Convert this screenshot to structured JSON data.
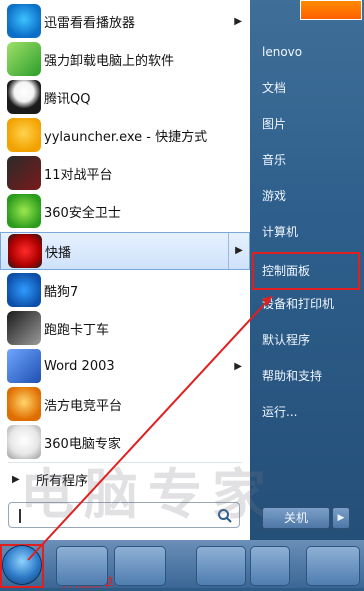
{
  "left_programs": [
    {
      "label": "迅雷看看播放器",
      "arrow": "▶",
      "icon": "xunlei-kankan-icon"
    },
    {
      "label": "强力卸载电脑上的软件",
      "arrow": "",
      "icon": "uninstall-icon"
    },
    {
      "label": "腾讯QQ",
      "arrow": "",
      "icon": "qq-penguin-icon"
    },
    {
      "label": "yylauncher.exe - 快捷方式",
      "arrow": "",
      "icon": "yy-launcher-icon"
    },
    {
      "label": "11对战平台",
      "arrow": "",
      "icon": "battle-platform-icon"
    },
    {
      "label": "360安全卫士",
      "arrow": "",
      "icon": "360-safe-icon"
    },
    {
      "label": "快播",
      "arrow": "▶",
      "icon": "kuaibo-icon"
    },
    {
      "label": "酷狗7",
      "arrow": "",
      "icon": "kugou-icon"
    },
    {
      "label": "跑跑卡丁车",
      "arrow": "",
      "icon": "kartrider-icon"
    },
    {
      "label": "Word 2003",
      "arrow": "▶",
      "icon": "word-icon"
    },
    {
      "label": "浩方电竞平台",
      "arrow": "",
      "icon": "haofang-icon"
    },
    {
      "label": "360电脑专家",
      "arrow": "",
      "icon": "360-expert-icon"
    }
  ],
  "all_programs": {
    "label": "所有程序",
    "arrow": "▶"
  },
  "search": {
    "placeholder": ""
  },
  "right_items": [
    {
      "label": "lenovo"
    },
    {
      "label": "文档"
    },
    {
      "label": "图片"
    },
    {
      "label": "音乐"
    },
    {
      "label": "游戏"
    },
    {
      "label": "计算机"
    },
    {
      "label": "控制面板"
    },
    {
      "label": "设备和打印机"
    },
    {
      "label": "默认程序"
    },
    {
      "label": "帮助和支持"
    },
    {
      "label": "运行..."
    }
  ],
  "shutdown": {
    "label": "关机",
    "arrow": "▶"
  },
  "watermark": {
    "text": "电脑专家"
  },
  "taskbar": {
    "start_label": "开始菜单"
  },
  "colors": {
    "highlight": "#e02020",
    "menu_bg": "#ffffff",
    "right_panel": "#2e5f8c"
  }
}
